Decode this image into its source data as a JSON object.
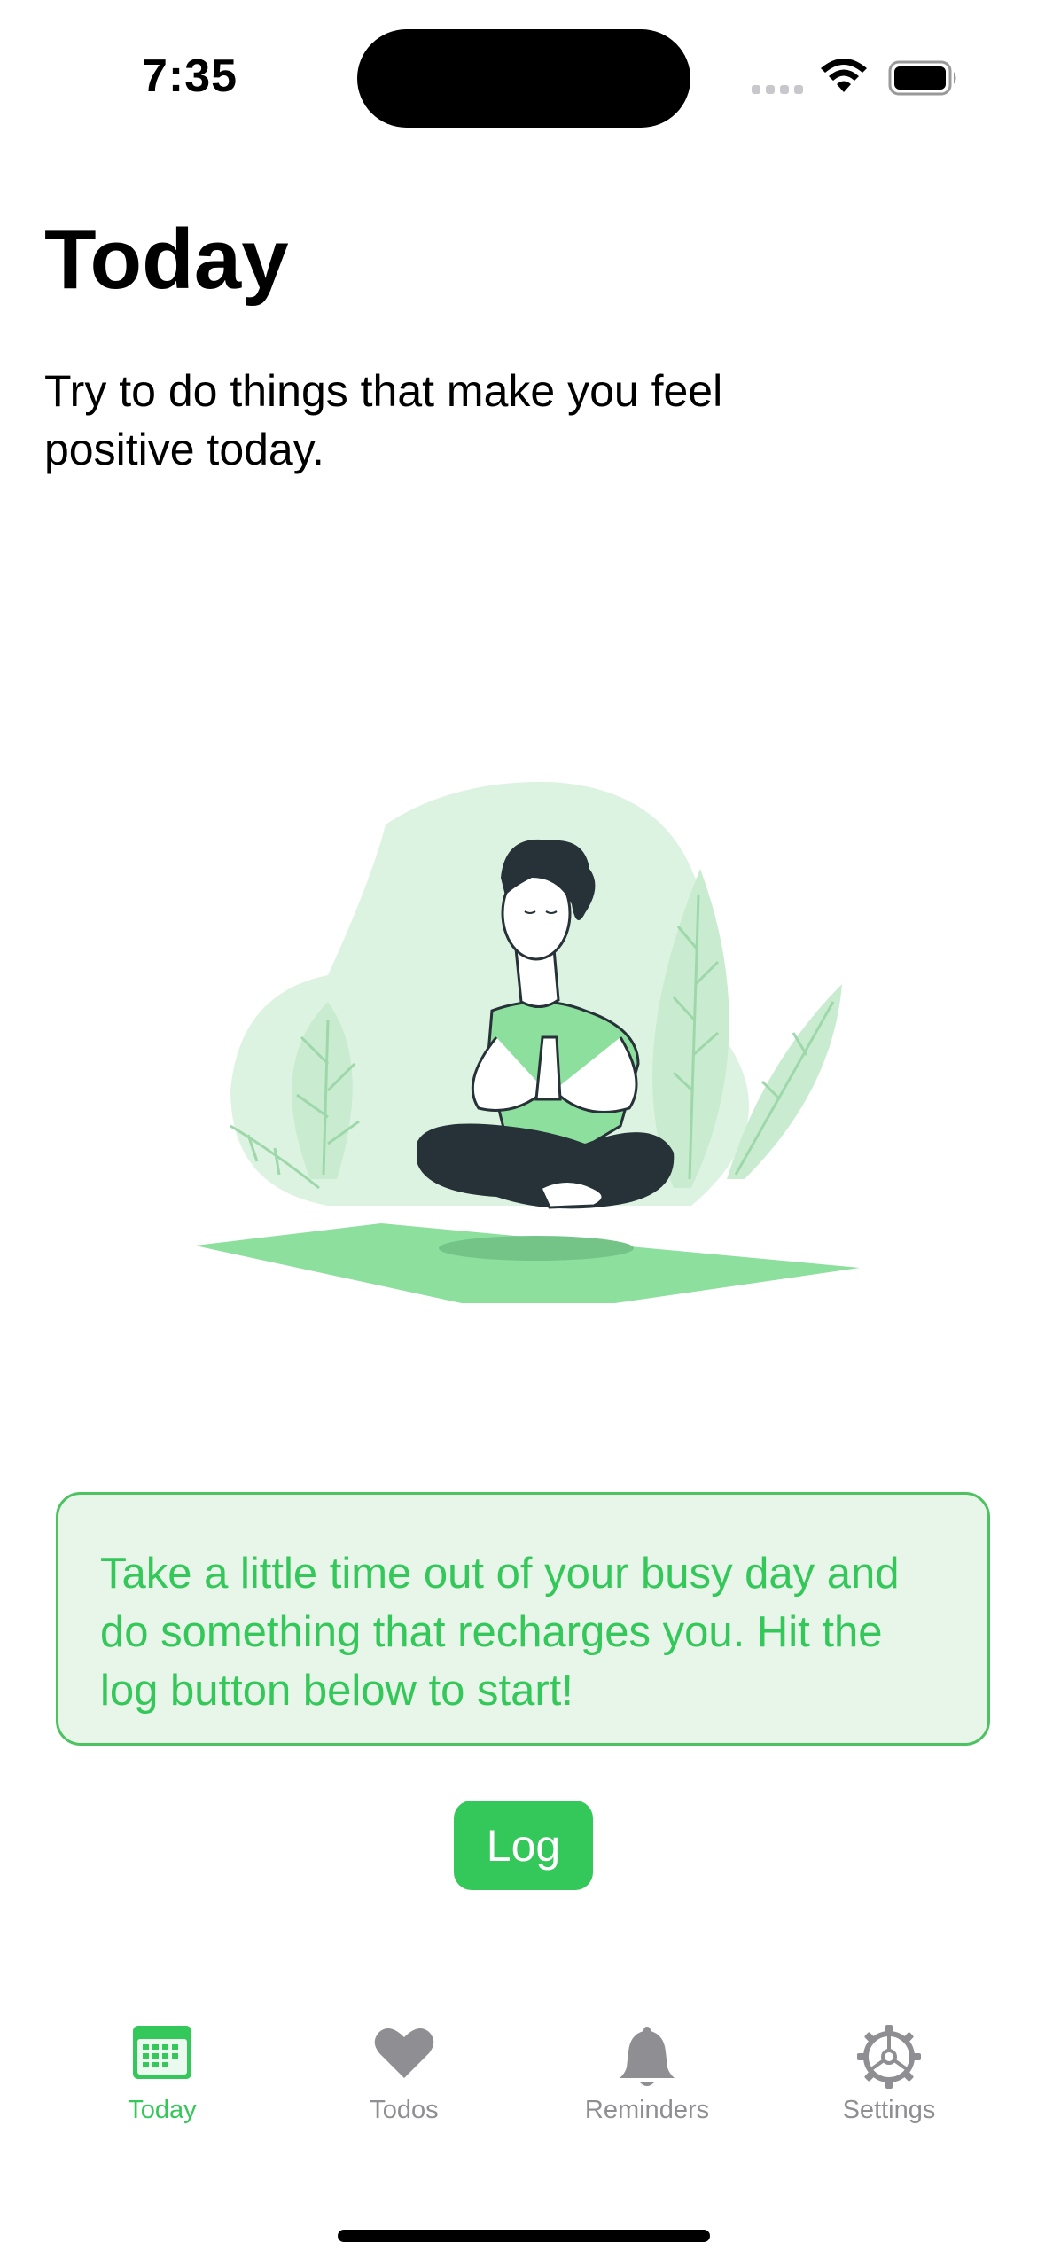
{
  "status": {
    "time": "7:35"
  },
  "main": {
    "title": "Today",
    "subtitle": "Try to do things that make you feel positive today.",
    "message": "Take a little time out of your busy day and do something that recharges you. Hit the log button below to start!",
    "log_label": "Log"
  },
  "tabs": [
    {
      "label": "Today",
      "icon": "calendar-icon",
      "active": true
    },
    {
      "label": "Todos",
      "icon": "heart-icon",
      "active": false
    },
    {
      "label": "Reminders",
      "icon": "bell-icon",
      "active": false
    },
    {
      "label": "Settings",
      "icon": "gear-icon",
      "active": false
    }
  ],
  "colors": {
    "accent": "#34c759",
    "inactive": "#8e8e93",
    "card_bg": "#e8f5e9",
    "illustration_light": "#ddf3e1",
    "illustration_mid": "#8ddf9e",
    "figure_dark": "#263238"
  }
}
